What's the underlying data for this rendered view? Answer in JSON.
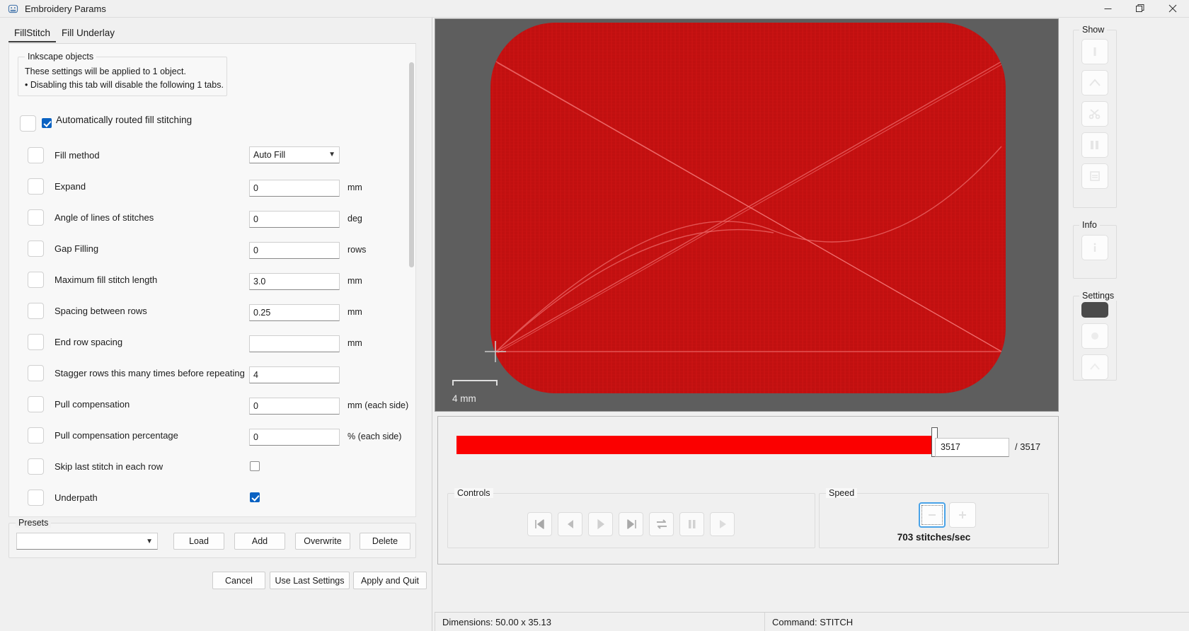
{
  "window": {
    "title": "Embroidery Params",
    "icon": "app-icon",
    "minimize_label": "—",
    "maximize_label": "❐",
    "close_label": "✕"
  },
  "tabs": [
    {
      "label": "FillStitch",
      "active": true
    },
    {
      "label": "Fill Underlay",
      "active": false
    }
  ],
  "inkscape_objects": {
    "title": "Inkscape objects",
    "line1": "These settings will be applied to 1 object.",
    "line2": "• Disabling this tab will disable the following 1 tabs."
  },
  "auto_route": {
    "label": "Automatically routed fill stitching",
    "checked": true
  },
  "fields": [
    {
      "label": "Fill method",
      "type": "select",
      "value": "Auto Fill",
      "units": ""
    },
    {
      "label": "Expand",
      "type": "text",
      "value": "0",
      "units": "mm"
    },
    {
      "label": "Angle of lines of stitches",
      "type": "text",
      "value": "0",
      "units": "deg"
    },
    {
      "label": "Gap Filling",
      "type": "text",
      "value": "0",
      "units": "rows"
    },
    {
      "label": "Maximum fill stitch length",
      "type": "text",
      "value": "3.0",
      "units": "mm"
    },
    {
      "label": "Spacing between rows",
      "type": "text",
      "value": "0.25",
      "units": "mm"
    },
    {
      "label": "End row spacing",
      "type": "text",
      "value": "",
      "units": "mm"
    },
    {
      "label": "Stagger rows this many times before repeating",
      "type": "text",
      "value": "4",
      "units": ""
    },
    {
      "label": "Pull compensation",
      "type": "text",
      "value": "0",
      "units": "mm (each side)"
    },
    {
      "label": "Pull compensation percentage",
      "type": "text",
      "value": "0",
      "units": "% (each side)"
    },
    {
      "label": "Skip last stitch in each row",
      "type": "checkbox",
      "value": false,
      "units": ""
    },
    {
      "label": "Underpath",
      "type": "checkbox",
      "value": true,
      "units": ""
    }
  ],
  "presets": {
    "title": "Presets",
    "selected": "",
    "buttons": [
      "Load",
      "Add",
      "Overwrite",
      "Delete"
    ]
  },
  "dialog_buttons": [
    "Cancel",
    "Use Last Settings",
    "Apply and Quit"
  ],
  "preview": {
    "scale_label": "4 mm",
    "stitch_color": "#c81010",
    "background": "#5e5e5e"
  },
  "playback": {
    "current_stitch": "3517",
    "total_stitch": "/ 3517",
    "progress_percent": 100,
    "controls_title": "Controls",
    "controls": [
      {
        "name": "skip-to-start-icon",
        "glyph": "skip-start"
      },
      {
        "name": "step-backward-icon",
        "glyph": "prev"
      },
      {
        "name": "play-icon",
        "glyph": "next"
      },
      {
        "name": "skip-to-end-icon",
        "glyph": "skip-end"
      },
      {
        "name": "loop-icon",
        "glyph": "loop"
      },
      {
        "name": "pause-icon",
        "glyph": "pause"
      },
      {
        "name": "play-forward-icon",
        "glyph": "play"
      }
    ],
    "speed_title": "Speed",
    "speed_buttons": [
      {
        "name": "speed-down-button",
        "glyph": "minus",
        "focused": true
      },
      {
        "name": "speed-up-button",
        "glyph": "plus",
        "focused": false
      }
    ],
    "speed_value": "703 stitches/sec"
  },
  "rail": {
    "show": {
      "title": "Show",
      "buttons": [
        {
          "name": "show-needle-penetration-icon",
          "glyph": "needle"
        },
        {
          "name": "show-jump-stitches-icon",
          "glyph": "jump"
        },
        {
          "name": "show-trims-icon",
          "glyph": "scissors"
        },
        {
          "name": "show-color-change-icon",
          "glyph": "bars"
        },
        {
          "name": "show-page-icon",
          "glyph": "page"
        }
      ]
    },
    "info": {
      "title": "Info",
      "buttons": [
        {
          "name": "info-icon",
          "glyph": "info"
        }
      ]
    },
    "settings": {
      "title": "Settings",
      "buttons": [
        {
          "name": "background-color-button",
          "glyph": "swatch",
          "dark": true
        },
        {
          "name": "theme-button",
          "glyph": "circle",
          "dark": false
        },
        {
          "name": "preferences-button",
          "glyph": "gear",
          "dark": false
        }
      ]
    }
  },
  "statusbar": {
    "dimensions": "Dimensions: 50.00 x 35.13",
    "command": "Command: STITCH"
  }
}
